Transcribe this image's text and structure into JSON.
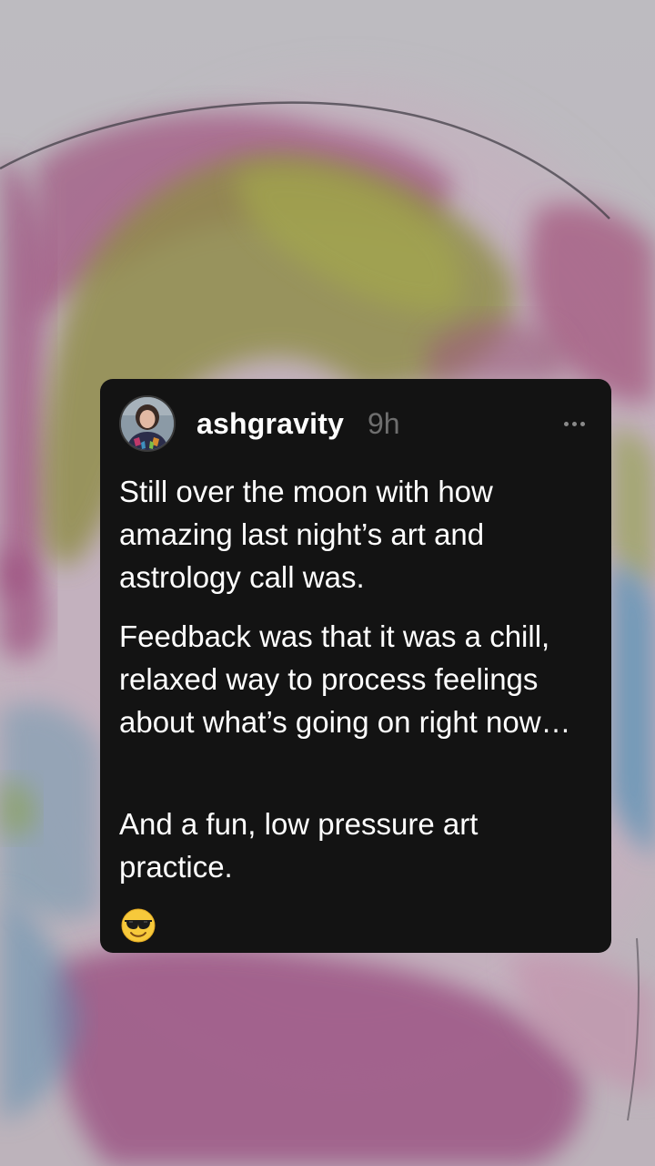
{
  "post": {
    "username": "ashgravity",
    "timestamp": "9h",
    "paragraphs": [
      "Still over the moon with how amazing last night’s art and astrology call was.",
      "Feedback was that it was a chill, relaxed way to process feelings about what’s going on right now…",
      "And a fun, low pressure art practice."
    ],
    "emoji": "smiling-face-with-sunglasses"
  },
  "icons": {
    "more": "more-horizontal-icon"
  },
  "colors": {
    "card_background": "#131313",
    "timestamp": "#6e6e6e",
    "text": "#ffffff"
  }
}
